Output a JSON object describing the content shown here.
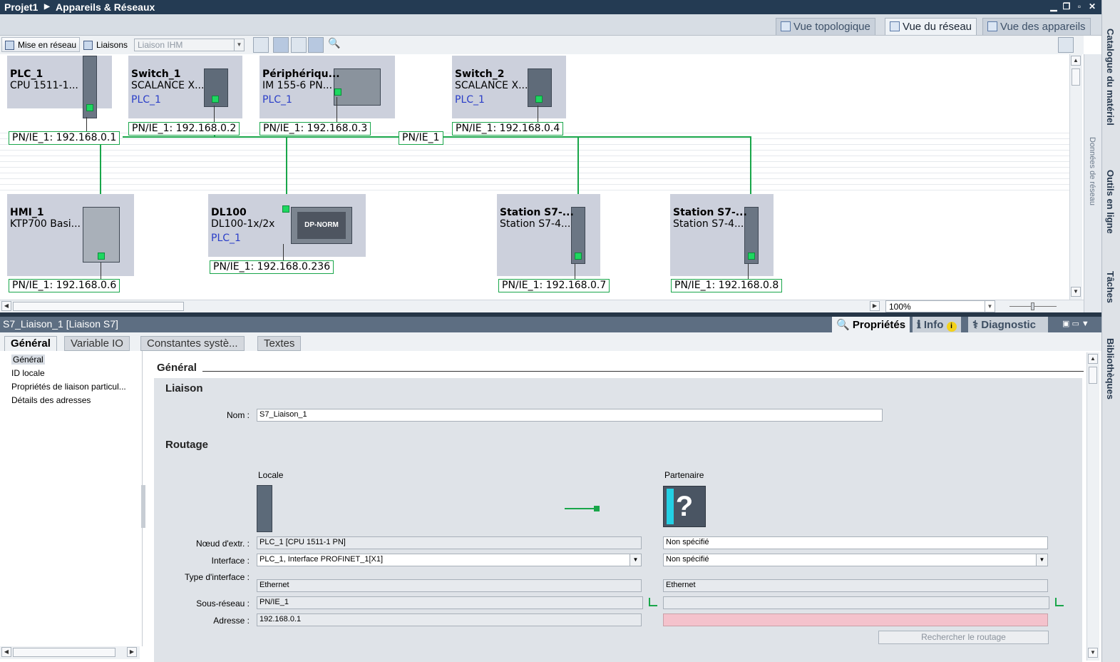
{
  "window": {
    "project": "Projet1",
    "title": "Appareils & Réseaux"
  },
  "view_tabs": {
    "topology": "Vue topologique",
    "network": "Vue du réseau",
    "devices": "Vue des appareils"
  },
  "toolbar": {
    "network_btn": "Mise en réseau",
    "connections_label": "Liaisons",
    "connection_type": "Liaison IHM"
  },
  "devices": {
    "plc1": {
      "name": "PLC_1",
      "type": "CPU 1511-1...",
      "address": "PN/IE_1:  192.168.0.1"
    },
    "switch1": {
      "name": "Switch_1",
      "type": "SCALANCE  X...",
      "plc": "PLC_1",
      "address": "PN/IE_1:  192.168.0.2"
    },
    "periph": {
      "name": "Périphériqu...",
      "type": "IM 155-6 PN...",
      "plc": "PLC_1",
      "address": "PN/IE_1:  192.168.0.3"
    },
    "switch2": {
      "name": "Switch_2",
      "type": "SCALANCE  X...",
      "plc": "PLC_1",
      "address": "PN/IE_1:  192.168.0.4"
    },
    "hmi1": {
      "name": "HMI_1",
      "type": "KTP700 Basi...",
      "address": "PN/IE_1:  192.168.0.6"
    },
    "dl100": {
      "name": "DL100",
      "type": "DL100-1x/2x",
      "plc": "PLC_1",
      "address": "PN/IE_1:  192.168.0.236",
      "module_text": "DP-NORM"
    },
    "station1": {
      "name": "Station S7-...",
      "type": "Station S7-4...",
      "address": "PN/IE_1:  192.168.0.7"
    },
    "station2": {
      "name": "Station S7-...",
      "type": "Station S7-4...",
      "address": "PN/IE_1:  192.168.0.8"
    }
  },
  "network_label": "PN/IE_1",
  "zoom": "100%",
  "inspector": {
    "title": "S7_Liaison_1 [Liaison S7]",
    "tabs": {
      "properties": "Propriétés",
      "info": "Info",
      "diagnostic": "Diagnostic"
    },
    "prop_tabs": [
      "Général",
      "Variable IO",
      "Constantes systè...",
      "Textes"
    ],
    "nav": [
      "Général",
      "ID locale",
      "Propriétés de liaison particul...",
      "Détails des adresses"
    ],
    "section_title": "Général",
    "liaison_title": "Liaison",
    "name_label": "Nom :",
    "name_value": "S7_Liaison_1",
    "routing_title": "Routage",
    "local_label": "Locale",
    "partner_label": "Partenaire",
    "labels": {
      "end_node": "Nœud d'extr. :",
      "interface": "Interface :",
      "iface_type": "Type d'interface :",
      "subnet": "Sous-réseau :",
      "address": "Adresse :"
    },
    "local": {
      "end_node": "PLC_1 [CPU 1511-1 PN]",
      "interface": "PLC_1, Interface PROFINET_1[X1]",
      "iface_type": "Ethernet",
      "subnet": "PN/IE_1",
      "address": "192.168.0.1"
    },
    "partner": {
      "end_node": "Non spécifié",
      "interface": "Non spécifié",
      "iface_type": "Ethernet",
      "subnet": "",
      "address": ""
    },
    "find_route": "Rechercher le routage"
  },
  "side_panels": {
    "catalog": "Catalogue du matériel",
    "online": "Outils en ligne",
    "tasks": "Tâches",
    "libraries": "Bibliothèques",
    "network_data": "Données de réseau"
  },
  "colors": {
    "title_bar": "#243b53",
    "network_line": "#19a64a",
    "port": "#1ed760",
    "device_bg": "#ccd0dc"
  }
}
